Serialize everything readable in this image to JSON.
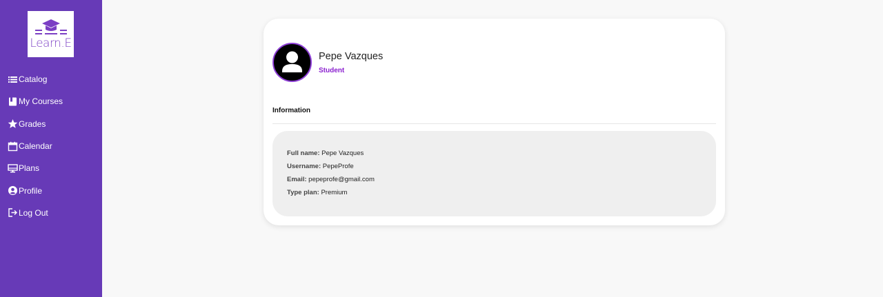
{
  "brand": {
    "name": "Learn.E"
  },
  "nav": {
    "items": [
      {
        "label": "Catalog",
        "icon": "list-icon"
      },
      {
        "label": "My Courses",
        "icon": "book-icon"
      },
      {
        "label": "Grades",
        "icon": "star-icon"
      },
      {
        "label": "Calendar",
        "icon": "calendar-icon"
      },
      {
        "label": "Plans",
        "icon": "monitor-icon"
      },
      {
        "label": "Profile",
        "icon": "account-circle-icon"
      },
      {
        "label": "Log Out",
        "icon": "logout-icon"
      }
    ]
  },
  "profile": {
    "name": "Pepe Vazques",
    "role": "Student",
    "section_title": "Information",
    "fields": [
      {
        "label": "Full name:",
        "value": "Pepe Vazques"
      },
      {
        "label": "Username:",
        "value": "PepeProfe"
      },
      {
        "label": "Email:",
        "value": "pepeprofe@gmail.com"
      },
      {
        "label": "Type plan:",
        "value": "Premium"
      }
    ]
  },
  "colors": {
    "sidebar": "#673ab7",
    "accent": "#8a1fcf",
    "background": "#f8f8f8"
  }
}
